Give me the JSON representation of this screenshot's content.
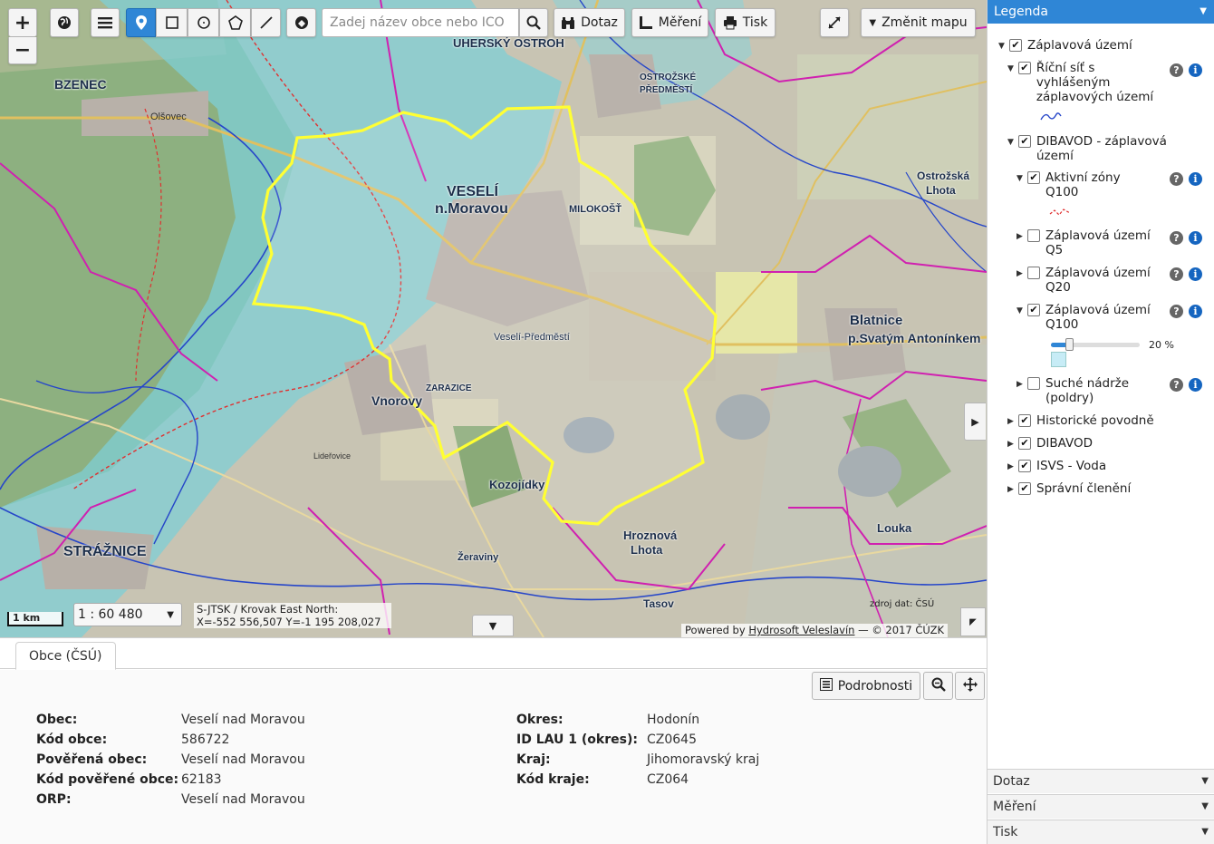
{
  "toolbar": {
    "zoom_in": "+",
    "zoom_out": "−",
    "search_placeholder": "Zadej název obce nebo ICO",
    "dotaz_label": "Dotaz",
    "mereni_label": "Měření",
    "tisk_label": "Tisk",
    "zmenit_mapu_label": "Změnit mapu"
  },
  "map": {
    "scale_bar": "1 km",
    "scale": "1 : 60 480",
    "coords_line1": "S-JTSK / Krovak East North:",
    "coords_line2": "X=-552 556,507 Y=-1 195 208,027",
    "attribution_prefix": "Powered by",
    "attribution_link": "Hydrosoft Veleslavín",
    "attribution_suffix": "— © 2017 ČÚZK",
    "data_source": "zdroj dat: ČSÚ",
    "labels": {
      "veseli": "VESELÍ",
      "veseli2": "n.Moravou",
      "bzenec": "BZENEC",
      "straznice": "STRÁŽNICE",
      "blatnice": "Blatnice",
      "blatnice2": "p.Svatým Antonínkem",
      "vnorovy": "Vnorovy",
      "kozojidky": "Kozojídky",
      "hroznova": "Hroznová",
      "hroznova2": "Lhota",
      "ostrozska": "Ostrožská",
      "ostrozska2": "Lhota",
      "louka": "Louka",
      "milokost": "MILOKOŠŤ",
      "zarazice": "ZARAZICE",
      "veseli_predmesti": "Veselí-Předměstí",
      "uhersky_ostroh": "UHERSKÝ OSTROH",
      "ostrozske_predmesti": "OSTROŽSKÉ",
      "ostrozske_predmesti2": "PŘEDMĚSTÍ",
      "tasov": "Tasov",
      "zeraviny": "Žeraviny",
      "lidherovice": "Lideřovice",
      "olsovec": "Olšovec"
    }
  },
  "bottom_panel": {
    "tab_label": "Obce (ČSÚ)",
    "details_label": "Podrobnosti",
    "left": [
      {
        "key": "Obec",
        "value": "Veselí nad Moravou"
      },
      {
        "key": "Kód obce",
        "value": "586722"
      },
      {
        "key": "Pověřená obec",
        "value": "Veselí nad Moravou"
      },
      {
        "key": "Kód pověřené obce",
        "value": "62183"
      },
      {
        "key": "ORP",
        "value": "Veselí nad Moravou"
      }
    ],
    "right": [
      {
        "key": "Okres",
        "value": "Hodonín"
      },
      {
        "key": "ID LAU 1 (okres)",
        "value": "CZ0645"
      },
      {
        "key": "Kraj",
        "value": "Jihomoravský kraj"
      },
      {
        "key": "Kód kraje",
        "value": "CZ064"
      }
    ]
  },
  "legend": {
    "title": "Legenda",
    "items": [
      {
        "label": "Záplavová území",
        "checked": true,
        "expanded": true
      },
      {
        "label": "Říční síť s vyhlášeným záplavových území",
        "checked": true,
        "expanded": true
      },
      {
        "label": "DIBAVOD - záplavová území",
        "checked": true,
        "expanded": true
      },
      {
        "label": "Aktivní zóny Q100",
        "checked": true,
        "expanded": true
      },
      {
        "label": "Záplavová území Q5",
        "checked": false,
        "expanded": false
      },
      {
        "label": "Záplavová území Q20",
        "checked": false,
        "expanded": false
      },
      {
        "label": "Záplavová území Q100",
        "checked": true,
        "expanded": true
      },
      {
        "label": "Suché nádrže (poldry)",
        "checked": false,
        "expanded": false
      },
      {
        "label": "Historické povodně",
        "checked": true,
        "expanded": false
      },
      {
        "label": "DIBAVOD",
        "checked": true,
        "expanded": false
      },
      {
        "label": "ISVS - Voda",
        "checked": true,
        "expanded": false
      },
      {
        "label": "Správní členění",
        "checked": true,
        "expanded": false
      }
    ],
    "opacity_value": "20 %",
    "opacity_fraction": 0.2,
    "bottom_sections": [
      "Dotaz",
      "Měření",
      "Tisk"
    ]
  },
  "colors": {
    "accent": "#2f86d6",
    "boundary_highlight": "#ffff33",
    "admin_boundary": "#d020b0",
    "flood_zone": "#7fd6e6"
  }
}
